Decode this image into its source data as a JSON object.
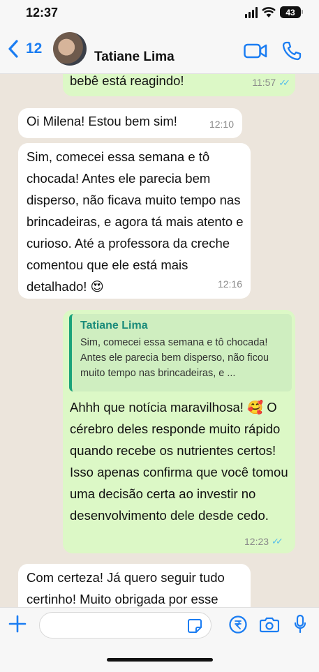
{
  "status": {
    "time": "12:37",
    "battery": "43"
  },
  "header": {
    "back_count": "12",
    "contact_name": "Tatiane Lima"
  },
  "messages": [
    {
      "dir": "out",
      "text": "bebê está reagindo!",
      "time": "11:57",
      "read": true
    },
    {
      "dir": "in",
      "text": "Oi Milena! Estou bem sim!",
      "time": "12:10"
    },
    {
      "dir": "in",
      "text": "Sim, comecei essa semana e tô chocada! Antes ele parecia bem disperso, não ficava muito tempo nas brincadeiras, e agora tá mais atento e curioso. Até a professora da creche comentou que ele está mais detalhado! 😍",
      "time": "12:16"
    },
    {
      "dir": "out",
      "quote": {
        "name": "Tatiane Lima",
        "text": "Sim, comecei essa semana e tô chocada! Antes ele parecia bem disperso, não ficou muito tempo nas brincadeiras, e ..."
      },
      "text": "Ahhh que notícia maravilhosa! 🥰 O cérebro deles responde muito rápido quando recebe os nutrientes certos! Isso apenas confirma que você tomou uma decisão certa ao investir no desenvolvimento dele desde cedo.",
      "time": "12:23",
      "read": true
    },
    {
      "dir": "in",
      "text": "Com certeza! Já quero seguir tudo certinho! Muito obrigada por esse"
    }
  ],
  "colors": {
    "accent": "#1b7df2",
    "outgoing": "#dcf8c6",
    "incoming": "#ffffff",
    "read_ticks": "#53bdeb"
  },
  "input": {
    "placeholder": ""
  }
}
